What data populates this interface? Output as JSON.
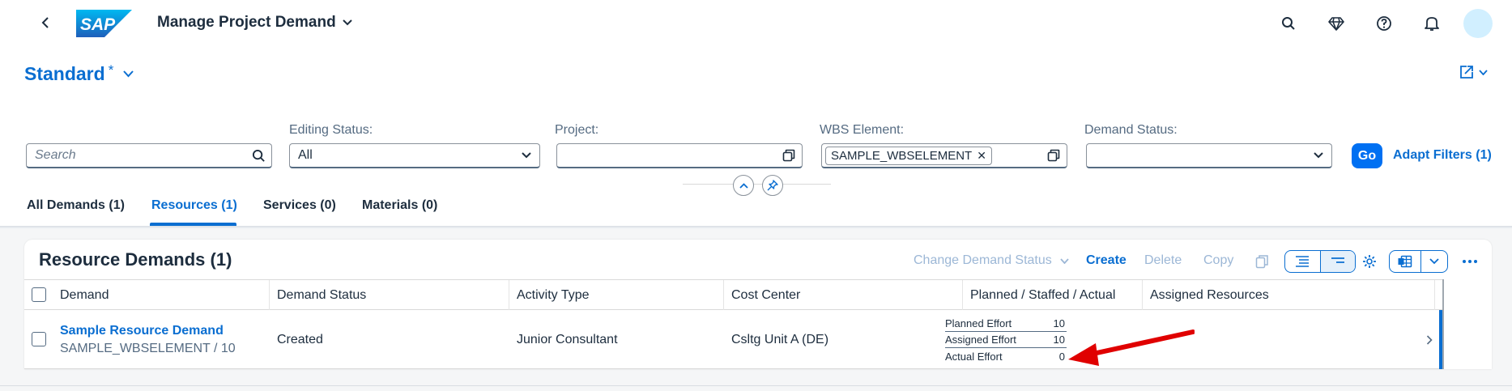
{
  "shell": {
    "app_title": "Manage Project Demand",
    "icons": [
      "back-icon",
      "search-icon",
      "diamond-icon",
      "help-icon",
      "bell-icon",
      "avatar"
    ],
    "logo_text": "SAP"
  },
  "header": {
    "variant_name": "Standard",
    "variant_modified": "*"
  },
  "filters": {
    "search": {
      "placeholder": "Search"
    },
    "editing_status": {
      "label": "Editing Status:",
      "value": "All"
    },
    "project": {
      "label": "Project:",
      "value": ""
    },
    "wbs_element": {
      "label": "WBS Element:",
      "token": "SAMPLE_WBSELEMENT"
    },
    "demand_status": {
      "label": "Demand Status:",
      "value": ""
    },
    "go_label": "Go",
    "adapt_label": "Adapt Filters (1)"
  },
  "tabs": [
    {
      "label": "All Demands (1)"
    },
    {
      "label": "Resources (1)"
    },
    {
      "label": "Services (0)"
    },
    {
      "label": "Materials (0)"
    }
  ],
  "table": {
    "title": "Resource Demands (1)",
    "toolbar": {
      "change_status": "Change Demand Status",
      "create": "Create",
      "delete": "Delete",
      "copy": "Copy"
    },
    "columns": [
      "Demand",
      "Demand Status",
      "Activity Type",
      "Cost Center",
      "Planned / Staffed / Actual",
      "Assigned Resources"
    ],
    "rows": [
      {
        "demand": "Sample Resource Demand",
        "demand_sub": "SAMPLE_WBSELEMENT / 10",
        "status": "Created",
        "activity_type": "Junior Consultant",
        "cost_center": "Csltg Unit A (DE)",
        "efforts": [
          {
            "label": "Planned Effort",
            "value": "10"
          },
          {
            "label": "Assigned Effort",
            "value": "10"
          },
          {
            "label": "Actual Effort",
            "value": "0"
          }
        ]
      }
    ]
  },
  "colors": {
    "brand_blue": "#0a6ed1",
    "go_button": "#0070f2",
    "annotation_arrow": "#e00000"
  }
}
